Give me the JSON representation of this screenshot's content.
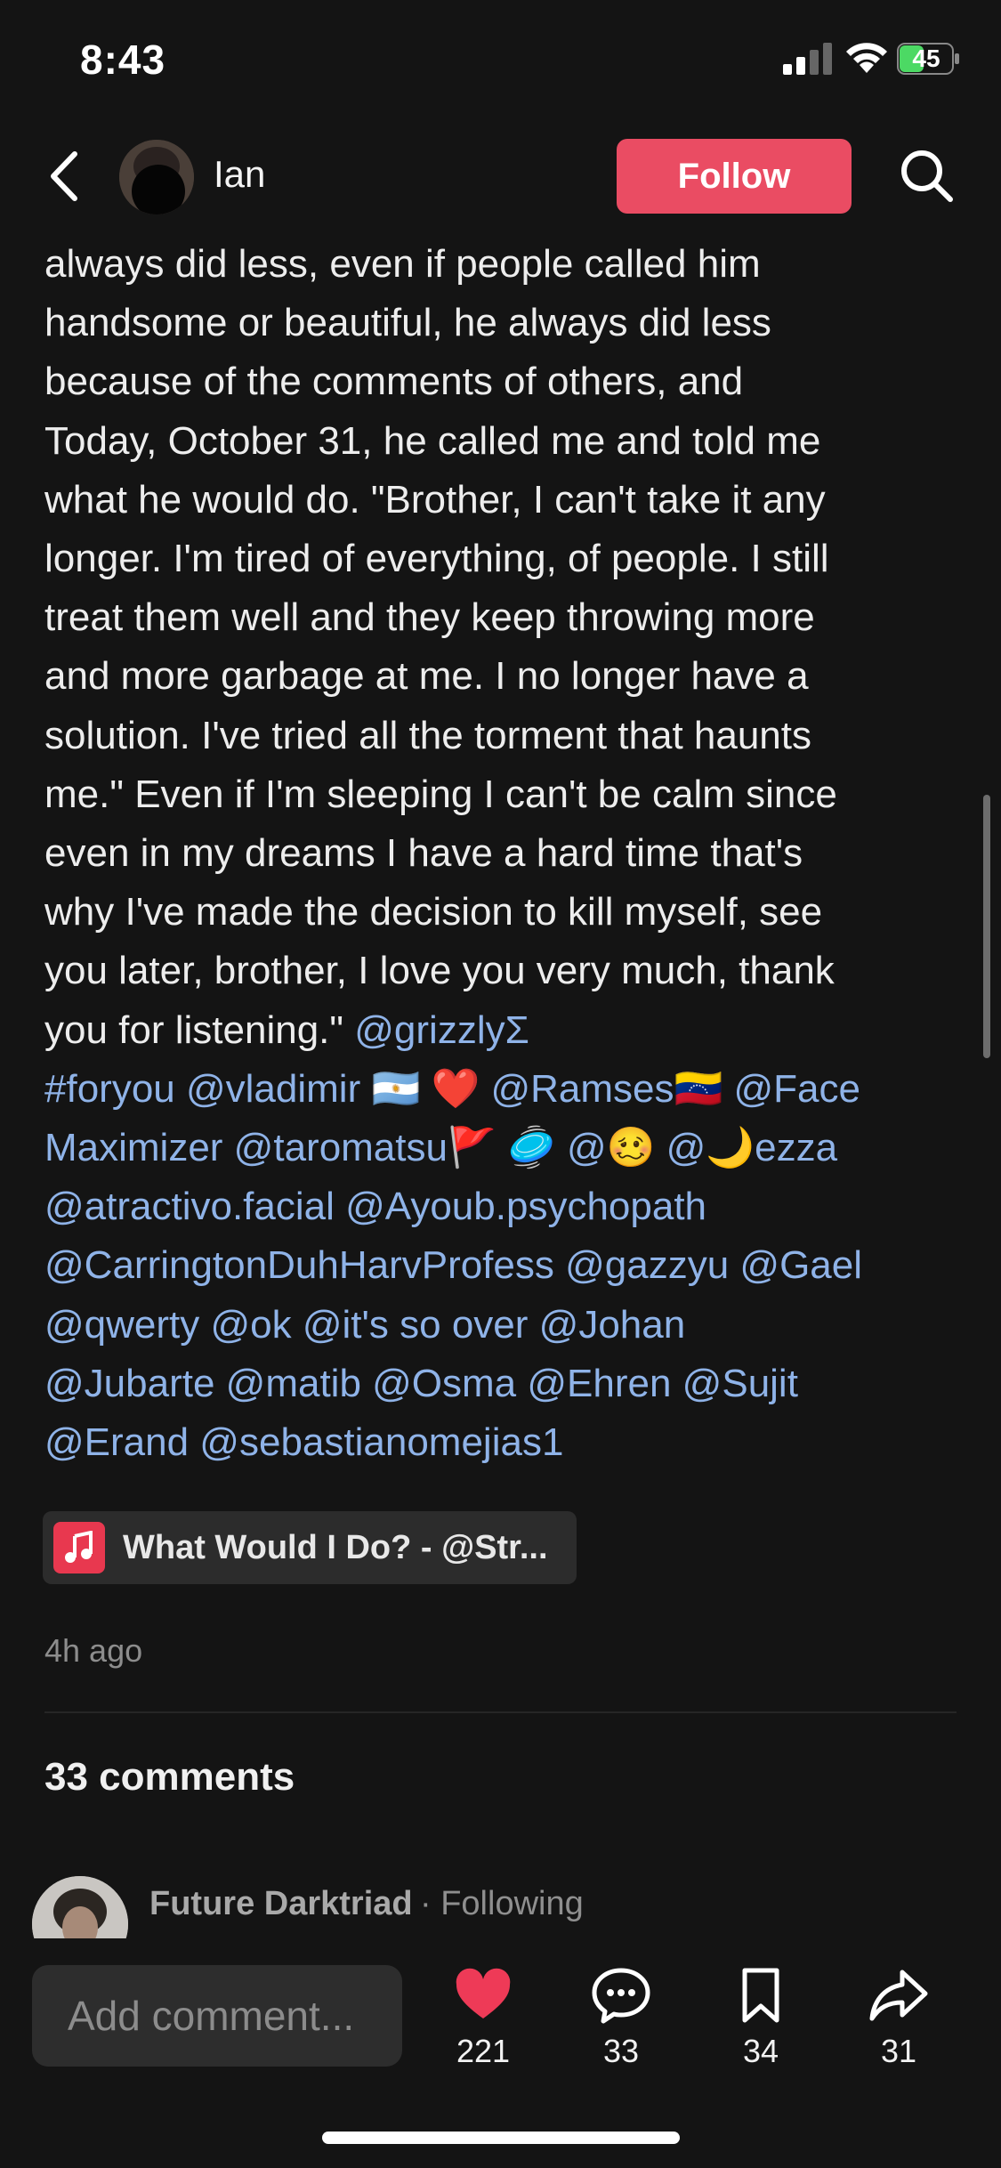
{
  "status_bar": {
    "time": "8:43",
    "battery": "45"
  },
  "header": {
    "username": "Ian",
    "follow_label": "Follow"
  },
  "caption": {
    "lines": [
      "always did less, even if people called him",
      "handsome or beautiful, he always did less",
      "because of the comments of others, and",
      "Today, October 31, he called me and told me",
      "what he would do. \"Brother, I can't take it any",
      "longer. I'm tired of everything, of people. I still",
      "treat them well and they keep throwing more",
      "and more garbage at me. I no longer have a",
      "solution. I've tried all the torment that haunts",
      "me.\" Even if I'm sleeping I can't be calm since",
      "even in my dreams I have a hard time that's",
      "why I've made the decision to kill myself, see",
      "you later, brother, I love you very much, thank"
    ],
    "last_line": "you for listening.\"",
    "mention_line_1": "@grizzlyΣ",
    "tag_lines": [
      "#foryou @vladimir 🇦🇷 ❤️ @Ramses🇻🇪 @Face",
      "Maximizer @taromatsu🚩 🥏 @🥴 @🌙ezza",
      "@atractivo.facial @Ayoub.psychopath",
      "@CarringtonDuhHarvProfess @gazzyu @Gael",
      "@qwerty @ok @it's so over @Johan",
      "@Jubarte @matib @Osma @Ehren @Sujit",
      "@Erand @sebastianomejias1"
    ]
  },
  "music": {
    "label": "What Would I Do? - @Str..."
  },
  "post_meta": {
    "timestamp": "4h ago",
    "comments_count": "33 comments"
  },
  "first_comment": {
    "author": "Future Darktriad",
    "status": "· Following"
  },
  "bottom_bar": {
    "comment_placeholder": "Add comment...",
    "likes": "221",
    "comments": "33",
    "saves": "34",
    "shares": "31"
  },
  "colors": {
    "background": "#141414",
    "accent": "#ea4c63",
    "link": "#8fb3e8"
  }
}
